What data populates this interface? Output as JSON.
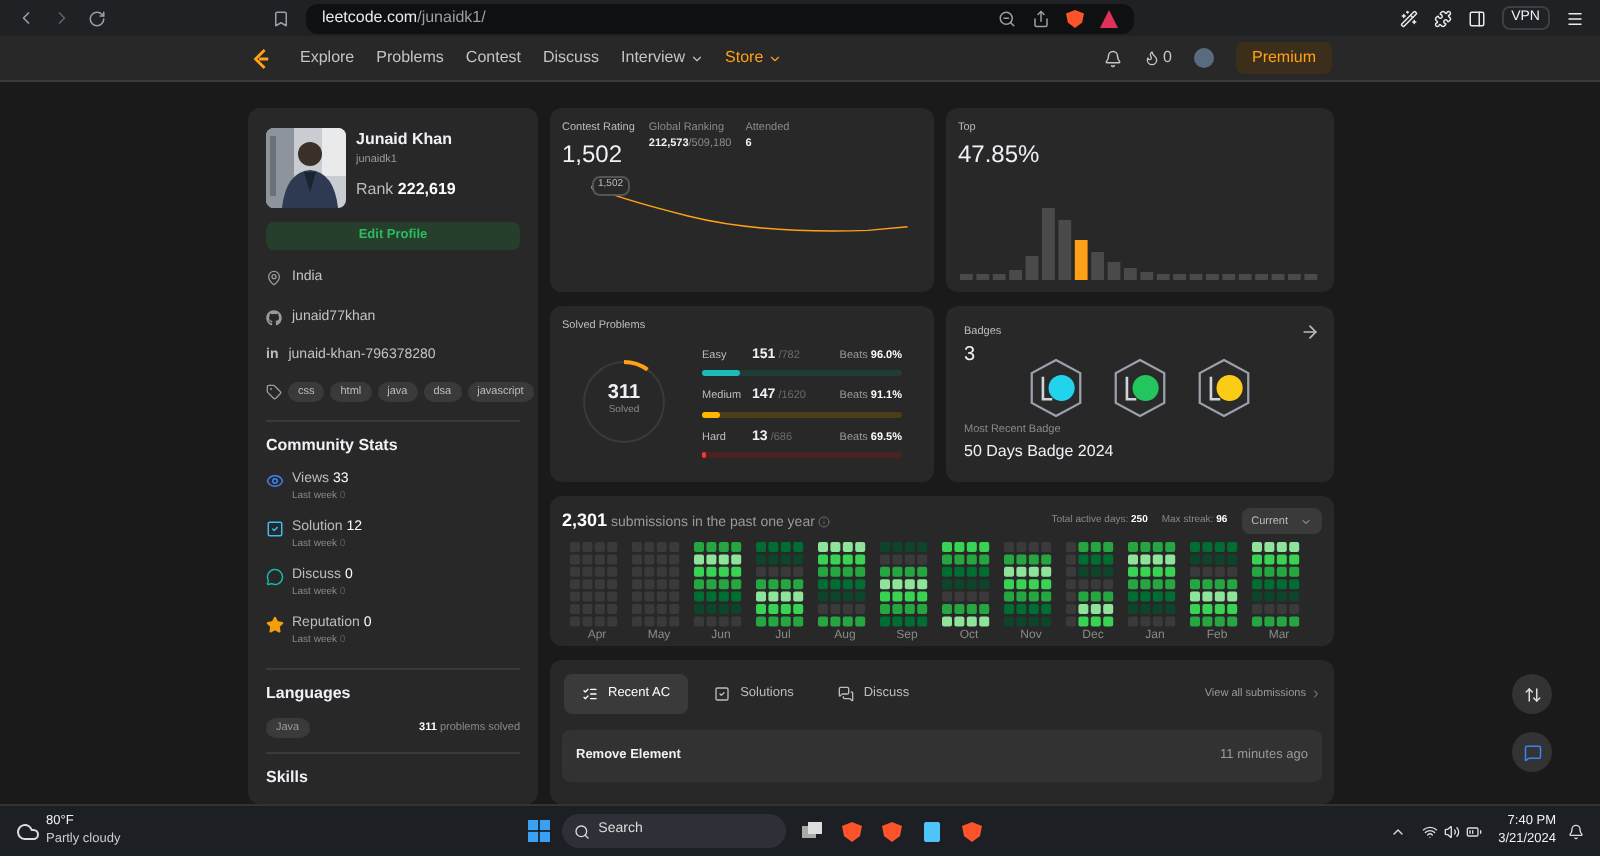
{
  "browser": {
    "url_host": "leetcode.com",
    "url_path": "/junaidk1/",
    "vpn": "VPN"
  },
  "nav": {
    "links": [
      {
        "label": "Explore",
        "kind": "link"
      },
      {
        "label": "Problems",
        "kind": "link"
      },
      {
        "label": "Contest",
        "kind": "link"
      },
      {
        "label": "Discuss",
        "kind": "link"
      },
      {
        "label": "Interview",
        "kind": "dropdown"
      },
      {
        "label": "Store",
        "kind": "store"
      }
    ],
    "points": "0",
    "premium": "Premium"
  },
  "profile": {
    "name": "Junaid Khan",
    "username": "junaidk1",
    "rank_label": "Rank",
    "rank": "222,619",
    "edit": "Edit Profile",
    "location": "India",
    "github": "junaid77khan",
    "linkedin_glyph": "in",
    "linkedin": "junaid-khan-796378280",
    "skills_tags": [
      "css",
      "html",
      "java",
      "dsa",
      "javascript"
    ]
  },
  "community": {
    "title": "Community Stats",
    "items": [
      {
        "kind": "views",
        "label": "Views",
        "value": "33",
        "note": "Last week",
        "note_value": "0"
      },
      {
        "kind": "solution",
        "label": "Solution",
        "value": "12",
        "note": "Last week",
        "note_value": "0"
      },
      {
        "kind": "discuss",
        "label": "Discuss",
        "value": "0",
        "note": "Last week",
        "note_value": "0"
      },
      {
        "kind": "reputation",
        "label": "Reputation",
        "value": "0",
        "note": "Last week",
        "note_value": "0"
      }
    ]
  },
  "languages": {
    "title": "Languages",
    "items": [
      {
        "name": "Java",
        "count": "311",
        "suffix": "problems solved"
      }
    ]
  },
  "skills": {
    "title": "Skills"
  },
  "contest": {
    "rating_label": "Contest Rating",
    "rating": "1,502",
    "global_label": "Global Ranking",
    "global": "212,573",
    "global_total": "/509,180",
    "attended_label": "Attended",
    "attended": "6",
    "point_label": "1,502"
  },
  "top": {
    "label": "Top",
    "value": "47.85%"
  },
  "solved": {
    "title": "Solved Problems",
    "total": "311",
    "total_label": "Solved",
    "level": 0.1,
    "rows": [
      {
        "kind": "easy",
        "label": "Easy",
        "count": "151",
        "total": "/782",
        "beats_label": "Beats",
        "beats": "96.0%",
        "level": 0.19
      },
      {
        "kind": "medium",
        "label": "Medium",
        "count": "147",
        "total": "/1620",
        "beats_label": "Beats",
        "beats": "91.1%",
        "level": 0.09
      },
      {
        "kind": "hard",
        "label": "Hard",
        "count": "13",
        "total": "/686",
        "beats_label": "Beats",
        "beats": "69.5%",
        "level": 0.02
      }
    ]
  },
  "badges": {
    "label": "Badges",
    "count": "3",
    "items": [
      {
        "color": "#22d3ee"
      },
      {
        "color": "#22c55e"
      },
      {
        "color": "#facc15"
      }
    ],
    "recent_label": "Most Recent Badge",
    "recent": "50 Days Badge 2024"
  },
  "submissions": {
    "count": "2,301",
    "text": "submissions in the past one year",
    "active_label": "Total active days:",
    "active": "250",
    "streak_label": "Max streak:",
    "streak": "96",
    "period": "Current",
    "months": [
      "Apr",
      "May",
      "Jun",
      "Jul",
      "Aug",
      "Sep",
      "Oct",
      "Nov",
      "Dec",
      "Jan",
      "Feb",
      "Mar"
    ]
  },
  "recent": {
    "tabs": [
      {
        "label": "Recent AC",
        "kind": "recent",
        "selected": true
      },
      {
        "label": "Solutions",
        "kind": "solutions",
        "selected": false
      },
      {
        "label": "Discuss",
        "kind": "discuss",
        "selected": false
      }
    ],
    "view_all": "View all submissions",
    "items": [
      {
        "title": "Remove Element",
        "time": "11 minutes ago"
      }
    ]
  },
  "taskbar": {
    "temp": "80°F",
    "weather": "Partly cloudy",
    "search": "Search",
    "time": "7:40 PM",
    "date": "3/21/2024"
  }
}
